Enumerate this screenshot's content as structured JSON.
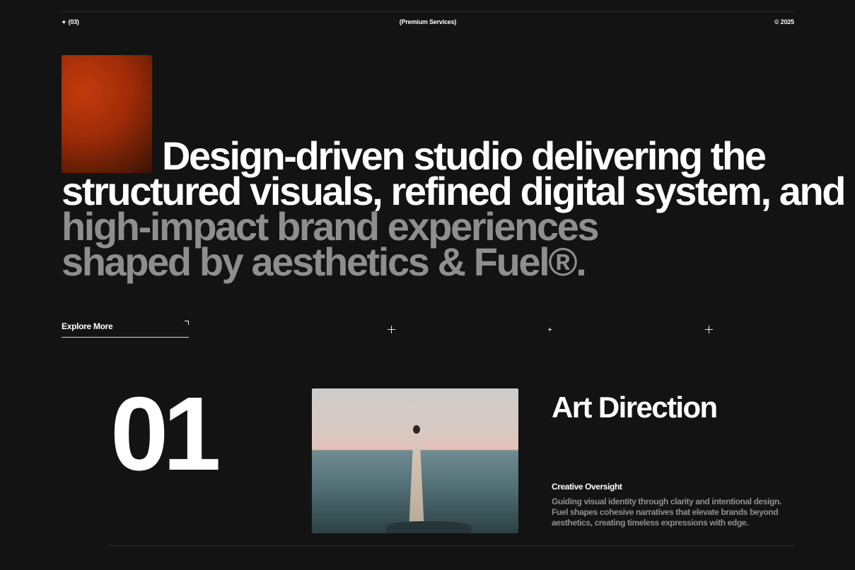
{
  "topbar": {
    "left": "(03)",
    "center": "(Premium Services)",
    "right": "© 2025"
  },
  "hero": {
    "line1": "Design-driven studio delivering the",
    "line2": "structured visuals, refined digital system, and",
    "line3": "high-impact brand experiences",
    "line4": "shaped by aesthetics & Fuel®."
  },
  "cta": {
    "label": "Explore More"
  },
  "service": {
    "number": "01",
    "title": "Art Direction",
    "subtitle": "Creative Oversight",
    "description": "Guiding visual identity through clarity and intentional design. Fuel shapes cohesive narratives that elevate brands beyond aesthetics, creating timeless expressions with edge."
  },
  "colors": {
    "background": "#131313",
    "text": "#ffffff",
    "muted": "#8e8e8e",
    "accent_orange": "#c43b0d"
  },
  "icons": [
    "star-icon",
    "arrow-up-right-icon",
    "plus-icon"
  ]
}
